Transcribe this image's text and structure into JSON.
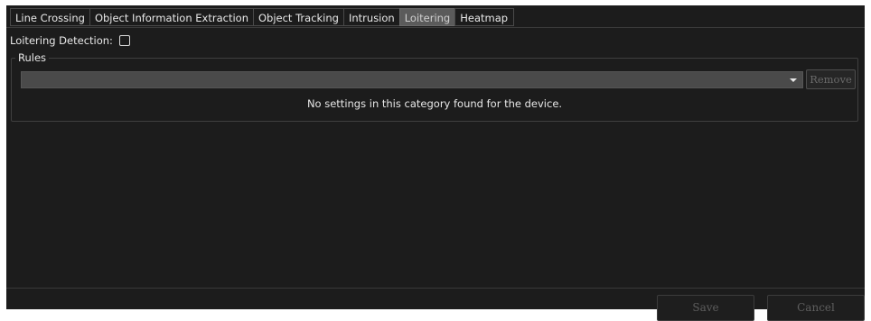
{
  "tabs": [
    {
      "label": "Line Crossing",
      "active": false
    },
    {
      "label": "Object Information Extraction",
      "active": false
    },
    {
      "label": "Object Tracking",
      "active": false
    },
    {
      "label": "Intrusion",
      "active": false
    },
    {
      "label": "Loitering",
      "active": true
    },
    {
      "label": "Heatmap",
      "active": false
    }
  ],
  "loitering": {
    "label": "Loitering Detection:",
    "checked": false
  },
  "rules": {
    "legend": "Rules",
    "selected_value": "",
    "remove_label": "Remove",
    "empty_message": "No settings in this category found for the device."
  },
  "footer": {
    "save_label": "Save",
    "cancel_label": "Cancel"
  },
  "icons": {
    "dropdown": "chevron-down-icon"
  },
  "colors": {
    "background": "#1c1c1c",
    "active_tab": "#5b5b5b",
    "select_field": "#4a4a4a",
    "text": "#e8e8e8",
    "disabled_text": "#5e5e5e"
  }
}
